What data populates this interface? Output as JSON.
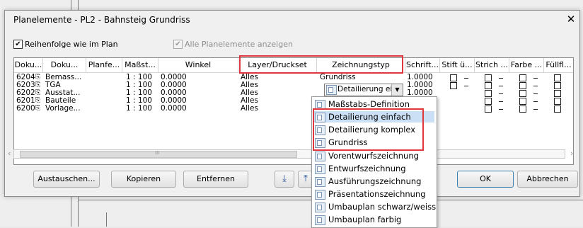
{
  "dialog": {
    "title": "Planelemente - PL2 - Bahnsteig Grundriss",
    "close_glyph": "✕",
    "options": {
      "order_label": "Reihenfolge wie im Plan",
      "order_checked": "✔",
      "show_all_label": "Alle Planelemente anzeigen",
      "show_all_checked": "✔"
    },
    "columns": [
      "Doku...",
      "Doku...",
      "Planfe...",
      "Maßst...",
      "Winkel",
      "Layer/Druckset",
      "Zeichnungstyp",
      "Schrift...",
      "Stift ü...",
      "Strich ...",
      "Farbe ...",
      "Füllfl..."
    ],
    "rows": [
      {
        "nr": "6204",
        "name": "Bemass...",
        "scale": "1 : 100",
        "angle": "0.0000",
        "layer": "Alles",
        "type": "Grundriss",
        "font": "1.0000"
      },
      {
        "nr": "6203",
        "name": "TGA",
        "scale": "1 : 100",
        "angle": "0.0000",
        "layer": "Alles",
        "type": "Detailierung einf",
        "font": "1.0000"
      },
      {
        "nr": "6202",
        "name": "Ausstat...",
        "scale": "1 : 100",
        "angle": "0.0000",
        "layer": "Alles",
        "type": "",
        "font": "1.0000"
      },
      {
        "nr": "6201",
        "name": "Bauteile",
        "scale": "1 : 100",
        "angle": "0.0000",
        "layer": "Alles",
        "type": "",
        "font": ""
      },
      {
        "nr": "6200",
        "name": "Vorlage...",
        "scale": "1 : 100",
        "angle": "0.0000",
        "layer": "Alles",
        "type": "",
        "font": ""
      }
    ],
    "scroll_mark": "III",
    "scroll_left": "‹",
    "scroll_right": "›",
    "buttons": {
      "replace": "Austauschen...",
      "copy": "Kopieren",
      "remove": "Entfernen",
      "down_glyph": "⤓",
      "up_glyph": "⤒",
      "ok": "OK",
      "cancel": "Abbrechen"
    },
    "dropdown": {
      "current_value": "Detailierung einf",
      "arrow_glyph": "▼",
      "items": [
        "Maßstabs-Definition",
        "Detailierung einfach",
        "Detailierung komplex",
        "Grundriss",
        "Vorentwurfszeichnung",
        "Entwurfszeichnung",
        "Ausführungszeichnung",
        "Präsentationszeichnung",
        "Umbauplan schwarz/weiss",
        "Umbauplan farbig"
      ],
      "selected_index": 1
    }
  },
  "colors": {
    "highlight_box": "#e0373f",
    "selection": "#cce0f5"
  }
}
